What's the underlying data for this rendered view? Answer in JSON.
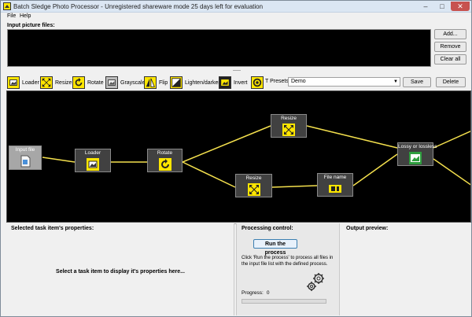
{
  "window": {
    "title": "Batch Sledge Photo Processor - Unregistered shareware mode 25 days left for evaluation",
    "minimize_glyph": "–",
    "maximize_glyph": "□",
    "close_glyph": "✕"
  },
  "menu": {
    "file": "File",
    "help": "Help"
  },
  "input_files": {
    "label": "Input picture files:",
    "add_label": "Add...",
    "remove_label": "Remove",
    "clear_all_label": "Clear all"
  },
  "toolbar": {
    "tools": [
      {
        "label": "Loader",
        "icon": "loader-icon"
      },
      {
        "label": "Resize",
        "icon": "resize-icon"
      },
      {
        "label": "Rotate",
        "icon": "rotate-icon"
      },
      {
        "label": "Grayscale",
        "icon": "grayscale-icon"
      },
      {
        "label": "Flip",
        "icon": "flip-icon"
      },
      {
        "label": "Lighten/darken",
        "icon": "lighten-darken-icon"
      },
      {
        "label": "Invert",
        "icon": "invert-icon"
      }
    ],
    "presets_label": "T Presets:",
    "presets_value": "Demo",
    "save_label": "Save",
    "delete_label": "Delete"
  },
  "graph": {
    "nodes": [
      {
        "id": "input",
        "label": "Input file",
        "icon": "file-icon"
      },
      {
        "id": "loader",
        "label": "Loader",
        "icon": "loader-icon"
      },
      {
        "id": "rotate",
        "label": "Rotate",
        "icon": "rotate-icon"
      },
      {
        "id": "resize1",
        "label": "Resize",
        "icon": "resize-icon"
      },
      {
        "id": "resize2",
        "label": "Resize",
        "icon": "resize-icon"
      },
      {
        "id": "filename",
        "label": "File name",
        "icon": "filename-icon"
      },
      {
        "id": "lossy",
        "label": "Lossy or lossless",
        "icon": "image-icon"
      }
    ],
    "line_color": "#f4e04d"
  },
  "properties": {
    "title": "Selected task item's properties:",
    "hint": "Select a task item to display it's properties here..."
  },
  "processing": {
    "title": "Processing control:",
    "run_label": "Run the process",
    "description": "Click 'Run the process' to process all files in the input file list with the defined process.",
    "progress_label": "Progress:",
    "progress_value": "0",
    "progress_fraction": 0
  },
  "preview": {
    "title": "Output preview:"
  },
  "colors": {
    "accent_yellow": "#ffe600",
    "graph_bg": "#000000",
    "progress_green": "#3cb043"
  }
}
